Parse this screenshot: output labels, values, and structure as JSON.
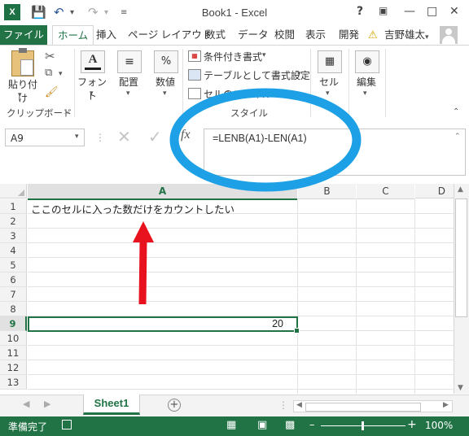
{
  "title": "Book1 - Excel",
  "tabs": {
    "file": "ファイル",
    "home": "ホーム",
    "insert": "挿入",
    "layout": "ページ レイアウト",
    "formulas": "数式",
    "data": "データ",
    "review": "校閲",
    "view": "表示",
    "developer": "開発",
    "user": "吉野雄太"
  },
  "ribbon": {
    "paste": "貼り付け",
    "clipboard": "クリップボード",
    "font": "フォント",
    "alignment": "配置",
    "number": "数値",
    "cond_format": "条件付き書式",
    "table_format": "テーブルとして書式設定",
    "cell_styles": "セルのスタイル",
    "styles_group": "スタイル",
    "cells": "セル",
    "editing": "編集"
  },
  "formula_bar": {
    "name_box": "A9",
    "formula": "=LENB(A1)-LEN(A1)"
  },
  "grid": {
    "columns": [
      "A",
      "B",
      "C",
      "D"
    ],
    "rows": [
      "1",
      "2",
      "3",
      "4",
      "5",
      "6",
      "7",
      "8",
      "9",
      "10",
      "11",
      "12",
      "13"
    ],
    "a1_text": "ここのセルに入った数だけをカウントしたい",
    "a9_value": "20"
  },
  "sheet_tab": "Sheet1",
  "status": {
    "ready": "準備完了",
    "zoom": "100%"
  },
  "colors": {
    "accent": "#217346",
    "arrow": "#e8121e",
    "circle": "#1ea0e6"
  }
}
